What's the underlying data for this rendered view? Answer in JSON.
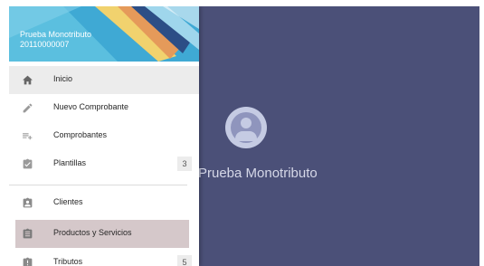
{
  "drawer": {
    "user_name": "Prueba Monotributo",
    "user_cuit": "20110000007",
    "items": [
      {
        "label": "Inicio",
        "icon": "home-icon",
        "active": true
      },
      {
        "label": "Nuevo Comprobante",
        "icon": "pencil-icon"
      },
      {
        "label": "Comprobantes",
        "icon": "list-add-icon"
      },
      {
        "label": "Plantillas",
        "icon": "clipboard-check-icon",
        "count": "3"
      },
      {
        "label": "Clientes",
        "icon": "contact-card-icon"
      },
      {
        "label": "Productos y Servicios",
        "icon": "clipboard-list-icon",
        "highlighted": true
      },
      {
        "label": "Tributos",
        "icon": "clipboard-alert-icon",
        "count": "5"
      }
    ]
  },
  "main": {
    "user_name": "Prueba Monotributo"
  },
  "colors": {
    "header_blue": "#58c0e0",
    "main_background": "#4b5078",
    "active_item": "#ececec",
    "highlighted_item": "#d5c8ca"
  }
}
